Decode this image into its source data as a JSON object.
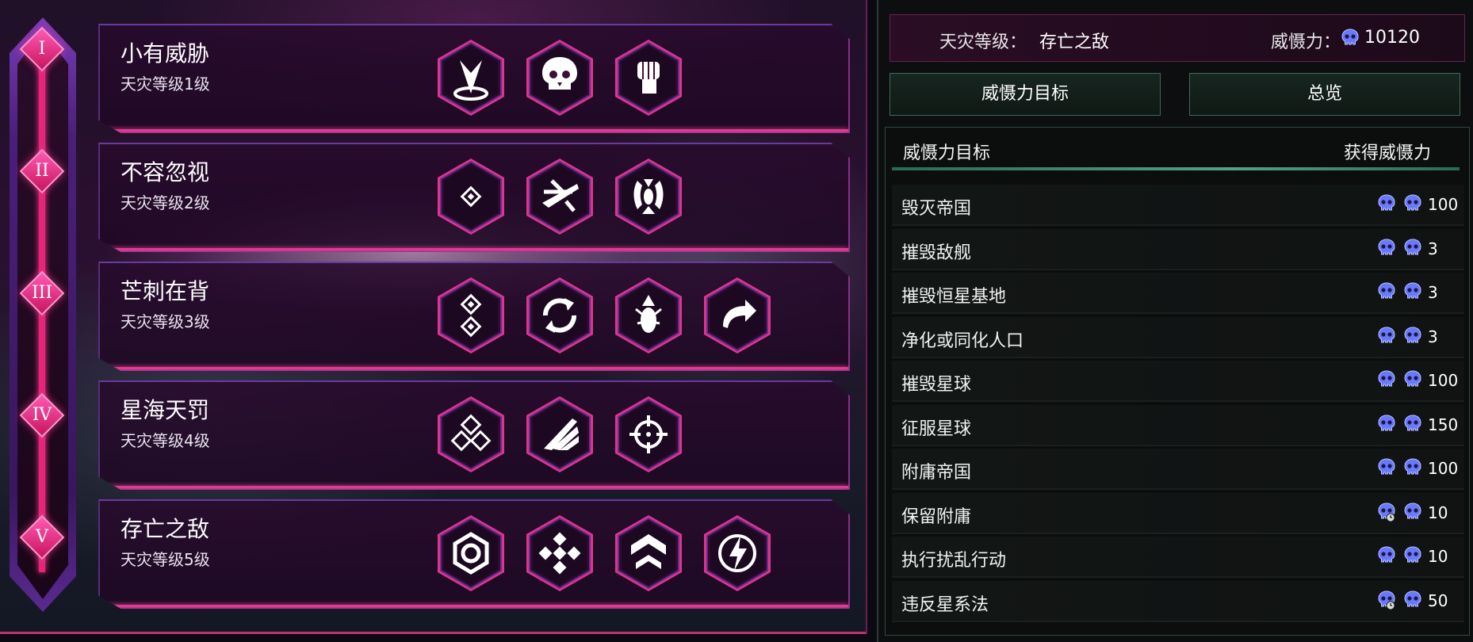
{
  "colors": {
    "accent": "#e8247a",
    "panel_green": "#3e6a58",
    "skull": "#6a78ff"
  },
  "tiers": [
    {
      "numeral": "I",
      "title": "小有威胁",
      "subtitle": "天灾等级1级",
      "icons": [
        "spike-target-icon",
        "skull-icon",
        "fist-icon"
      ]
    },
    {
      "numeral": "II",
      "title": "不容忽视",
      "subtitle": "天灾等级2级",
      "icons": [
        "small-diamond-icon",
        "slash-strike-icon",
        "claws-icon"
      ]
    },
    {
      "numeral": "III",
      "title": "芒刺在背",
      "subtitle": "天灾等级3级",
      "icons": [
        "double-diamond-icon",
        "cycle-arrows-icon",
        "bomb-icon",
        "redirect-arrow-icon"
      ]
    },
    {
      "numeral": "IV",
      "title": "星海天罚",
      "subtitle": "天灾等级4级",
      "icons": [
        "triple-diamond-icon",
        "claw-swipe-icon",
        "crosshair-icon"
      ]
    },
    {
      "numeral": "V",
      "title": "存亡之敌",
      "subtitle": "天灾等级5级",
      "icons": [
        "hexagon-shield-icon",
        "quad-diamond-icon",
        "chevron-rank-icon",
        "lightning-icon"
      ]
    }
  ],
  "summary": {
    "level_label": "天灾等级：",
    "level_value": "存亡之敌",
    "menace_label": "威慑力：",
    "menace_value": "10120"
  },
  "tabs": [
    {
      "label": "威慑力目标"
    },
    {
      "label": "总览"
    }
  ],
  "table": {
    "col_target": "威慑力目标",
    "col_gain": "获得威慑力",
    "rows": [
      {
        "name": "毁灭帝国",
        "value": "100",
        "timed": false
      },
      {
        "name": "摧毁敌舰",
        "value": "3",
        "timed": false
      },
      {
        "name": "摧毁恒星基地",
        "value": "3",
        "timed": false
      },
      {
        "name": "净化或同化人口",
        "value": "3",
        "timed": false
      },
      {
        "name": "摧毁星球",
        "value": "100",
        "timed": false
      },
      {
        "name": "征服星球",
        "value": "150",
        "timed": false
      },
      {
        "name": "附庸帝国",
        "value": "100",
        "timed": false
      },
      {
        "name": "保留附庸",
        "value": "10",
        "timed": true
      },
      {
        "name": "执行扰乱行动",
        "value": "10",
        "timed": false
      },
      {
        "name": "违反星系法",
        "value": "50",
        "timed": true
      }
    ]
  }
}
